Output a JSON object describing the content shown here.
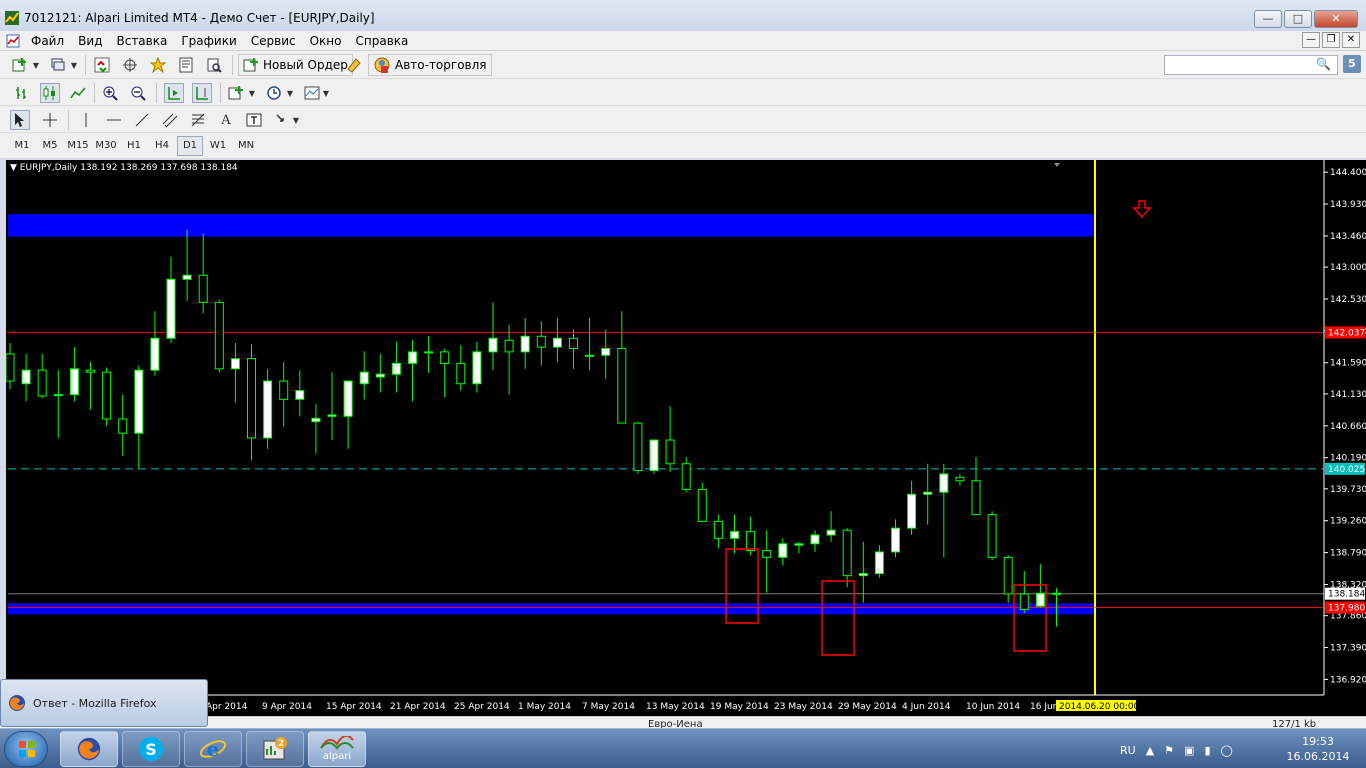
{
  "window": {
    "title": "7012121: Alpari Limited MT4 - Демо Счет - [EURJPY,Daily]",
    "minimize_icon": "minimize-icon",
    "maximize_icon": "maximize-icon",
    "close_icon": "close-icon"
  },
  "menu": {
    "items": [
      "Файл",
      "Вид",
      "Вставка",
      "Графики",
      "Сервис",
      "Окно",
      "Справка"
    ]
  },
  "toolbar": {
    "new_order_label": "Новый Ордер",
    "auto_trading_label": "Авто-торговля",
    "search_value": "",
    "counter": "5"
  },
  "timeframes": [
    "M1",
    "M5",
    "M15",
    "M30",
    "H1",
    "H4",
    "D1",
    "W1",
    "MN"
  ],
  "active_timeframe": "D1",
  "chart": {
    "header": "EURJPY,Daily  138.192 138.269 137.698 138.184",
    "bid_label": "138.184",
    "level_red_label": "142.037",
    "level_cyan_label": "140.025",
    "level_bottom_label": "137.980",
    "cursor_date_label": "2014.06.20 00:00",
    "colors": {
      "background": "#000000",
      "bull_body": "#ffffff",
      "bear_body": "#000000",
      "wick": "#00ff00",
      "zone": "#0000ff",
      "red_line": "#ff0000",
      "cyan_line": "#00c0c0",
      "yellow_line": "#ffff00"
    }
  },
  "chart_data": {
    "type": "candlestick",
    "symbol": "EURJPY,Daily",
    "ylim": [
      136.69,
      144.55
    ],
    "y_ticks": [
      144.4,
      143.93,
      143.46,
      143.0,
      142.53,
      142.06,
      141.59,
      141.13,
      140.66,
      140.19,
      139.73,
      139.26,
      138.79,
      138.32,
      137.86,
      137.39,
      136.92
    ],
    "y_tick_labels": [
      "144.400",
      "143.930",
      "143.460",
      "143.000",
      "142.530",
      "142.060",
      "141.590",
      "141.130",
      "140.660",
      "140.190",
      "139.730",
      "139.260",
      "138.790",
      "138.320",
      "137.860",
      "137.390",
      "136.920"
    ],
    "x_labels": [
      "Apr 2014",
      "9 Apr 2014",
      "15 Apr 2014",
      "21 Apr 2014",
      "25 Apr 2014",
      "1 May 2014",
      "7 May 2014",
      "13 May 2014",
      "19 May 2014",
      "23 May 2014",
      "29 May 2014",
      "4 Jun 2014",
      "10 Jun 2014",
      "16 Jun"
    ],
    "candles": [
      [
        141.72,
        141.88,
        141.2,
        141.32
      ],
      [
        141.28,
        141.72,
        141.02,
        141.48
      ],
      [
        141.48,
        141.72,
        141.07,
        141.1
      ],
      [
        141.12,
        141.48,
        140.48,
        141.12
      ],
      [
        141.12,
        141.82,
        141.02,
        141.5
      ],
      [
        141.48,
        141.6,
        140.9,
        141.45
      ],
      [
        141.45,
        141.52,
        140.66,
        140.76
      ],
      [
        140.76,
        141.12,
        140.22,
        140.55
      ],
      [
        140.55,
        141.55,
        140.02,
        141.48
      ],
      [
        141.48,
        142.35,
        141.4,
        141.95
      ],
      [
        141.95,
        143.15,
        141.88,
        142.82
      ],
      [
        142.82,
        143.55,
        142.5,
        142.88
      ],
      [
        142.88,
        143.5,
        142.32,
        142.48
      ],
      [
        142.48,
        142.52,
        141.45,
        141.5
      ],
      [
        141.5,
        141.88,
        141.0,
        141.65
      ],
      [
        141.65,
        141.86,
        140.15,
        140.48
      ],
      [
        140.48,
        141.5,
        140.32,
        141.32
      ],
      [
        141.32,
        141.6,
        140.65,
        141.05
      ],
      [
        141.05,
        141.48,
        140.8,
        141.18
      ],
      [
        140.72,
        140.98,
        140.25,
        140.77
      ],
      [
        140.8,
        141.45,
        140.45,
        140.82
      ],
      [
        140.8,
        141.3,
        140.32,
        141.32
      ],
      [
        141.28,
        141.76,
        141.05,
        141.45
      ],
      [
        141.38,
        141.72,
        141.15,
        141.42
      ],
      [
        141.42,
        141.9,
        141.15,
        141.58
      ],
      [
        141.58,
        141.92,
        141.02,
        141.75
      ],
      [
        141.75,
        141.98,
        141.44,
        141.75
      ],
      [
        141.75,
        141.8,
        141.08,
        141.58
      ],
      [
        141.58,
        141.85,
        141.18,
        141.28
      ],
      [
        141.28,
        141.9,
        141.15,
        141.75
      ],
      [
        141.75,
        142.48,
        141.48,
        141.95
      ],
      [
        141.92,
        142.15,
        141.12,
        141.75
      ],
      [
        141.75,
        142.25,
        141.5,
        141.98
      ],
      [
        141.98,
        142.2,
        141.55,
        141.82
      ],
      [
        141.82,
        142.25,
        141.6,
        141.95
      ],
      [
        141.95,
        142.08,
        141.5,
        141.8
      ],
      [
        141.7,
        142.25,
        141.48,
        141.7
      ],
      [
        141.7,
        142.08,
        141.35,
        141.8
      ],
      [
        141.8,
        142.35,
        141.45,
        140.7
      ],
      [
        140.7,
        140.72,
        139.95,
        140.0
      ],
      [
        140.0,
        140.45,
        139.95,
        140.45
      ],
      [
        140.45,
        140.95,
        139.98,
        140.1
      ],
      [
        140.1,
        140.2,
        139.68,
        139.72
      ],
      [
        139.72,
        139.82,
        139.25,
        139.25
      ],
      [
        139.25,
        139.35,
        138.85,
        139.0
      ],
      [
        139.0,
        139.35,
        138.78,
        139.1
      ],
      [
        139.1,
        139.32,
        138.75,
        138.82
      ],
      [
        138.82,
        139.12,
        138.2,
        138.72
      ],
      [
        138.72,
        139.0,
        138.6,
        138.92
      ],
      [
        138.9,
        138.95,
        138.78,
        138.92
      ],
      [
        138.92,
        139.12,
        138.8,
        139.05
      ],
      [
        139.05,
        139.4,
        138.95,
        139.12
      ],
      [
        139.12,
        139.15,
        138.28,
        138.45
      ],
      [
        138.45,
        138.95,
        138.05,
        138.48
      ],
      [
        138.48,
        138.9,
        138.42,
        138.8
      ],
      [
        138.8,
        139.28,
        138.72,
        139.15
      ],
      [
        139.15,
        139.85,
        139.05,
        139.65
      ],
      [
        139.65,
        140.1,
        139.2,
        139.68
      ],
      [
        139.68,
        140.1,
        138.72,
        139.95
      ],
      [
        139.9,
        139.95,
        139.78,
        139.85
      ],
      [
        139.85,
        140.2,
        139.45,
        139.35
      ],
      [
        139.35,
        139.4,
        138.68,
        138.72
      ],
      [
        138.72,
        138.75,
        138.05,
        138.18
      ],
      [
        138.18,
        138.52,
        137.9,
        137.95
      ],
      [
        138.0,
        138.62,
        137.98,
        138.19
      ],
      [
        138.19,
        138.27,
        137.7,
        138.18
      ]
    ],
    "levels": [
      {
        "label": "142.037",
        "value": 142.037,
        "style": "solid",
        "color": "#ff0000"
      },
      {
        "label": "140.025",
        "value": 140.025,
        "style": "dashed",
        "color": "#00c0c0"
      },
      {
        "label": "137.980",
        "value": 137.98,
        "style": "solid",
        "color": "#ff0000"
      }
    ],
    "zones": [
      {
        "from": 143.45,
        "to": 143.78,
        "color": "#0000ff"
      },
      {
        "from": 137.88,
        "to": 138.04,
        "color": "#0000ff"
      }
    ]
  },
  "bottom": {
    "tab_label": "Евро-Иена",
    "status_right": "127/1 kb"
  },
  "taskbar": {
    "firefox_popup": "Ответ - Mozilla Firefox",
    "alpari_label": "alpari",
    "lang": "RU",
    "time": "19:53",
    "date": "16.06.2014"
  }
}
